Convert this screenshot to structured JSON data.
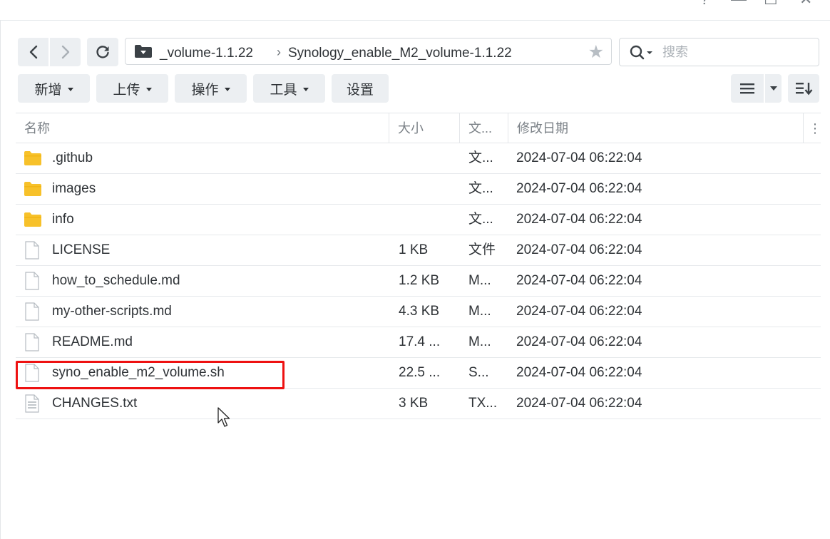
{
  "window": {
    "help_glyph": "?",
    "minimize_glyph": "—",
    "maximize_glyph": "☐",
    "close_glyph": "✕"
  },
  "nav": {
    "back_icon": "chevron-left-icon",
    "forward_icon": "chevron-right-icon",
    "refresh_icon": "refresh-icon"
  },
  "path": {
    "folder_icon": "folder-dropdown-icon",
    "crumbs": [
      "_volume-1.1.22",
      "Synology_enable_M2_volume-1.1.22"
    ],
    "separator": "›",
    "star_glyph": "★"
  },
  "search": {
    "icon": "search-icon",
    "placeholder": "搜索",
    "value": ""
  },
  "toolbar": {
    "buttons": [
      "新增",
      "上传",
      "操作",
      "工具",
      "设置"
    ]
  },
  "view": {
    "list_icon": "list-view-icon",
    "dropdown_icon": "caret-down-icon",
    "sort_icon": "sort-icon"
  },
  "table": {
    "columns": [
      "名称",
      "大小",
      "文...",
      "修改日期"
    ],
    "more_glyph": "⋮",
    "rows": [
      {
        "name": ".github",
        "size": "",
        "type": "文...",
        "modified": "2024-07-04 06:22:04",
        "icon": "folder-icon"
      },
      {
        "name": "images",
        "size": "",
        "type": "文...",
        "modified": "2024-07-04 06:22:04",
        "icon": "folder-icon"
      },
      {
        "name": "info",
        "size": "",
        "type": "文...",
        "modified": "2024-07-04 06:22:04",
        "icon": "folder-icon"
      },
      {
        "name": "LICENSE",
        "size": "1 KB",
        "type": "文件",
        "modified": "2024-07-04 06:22:04",
        "icon": "file-icon"
      },
      {
        "name": "how_to_schedule.md",
        "size": "1.2 KB",
        "type": "M...",
        "modified": "2024-07-04 06:22:04",
        "icon": "file-icon"
      },
      {
        "name": "my-other-scripts.md",
        "size": "4.3 KB",
        "type": "M...",
        "modified": "2024-07-04 06:22:04",
        "icon": "file-icon"
      },
      {
        "name": "README.md",
        "size": "17.4 ...",
        "type": "M...",
        "modified": "2024-07-04 06:22:04",
        "icon": "file-icon"
      },
      {
        "name": "syno_enable_m2_volume.sh",
        "size": "22.5 ...",
        "type": "S...",
        "modified": "2024-07-04 06:22:04",
        "icon": "file-icon",
        "highlighted": true
      },
      {
        "name": "CHANGES.txt",
        "size": "3 KB",
        "type": "TX...",
        "modified": "2024-07-04 06:22:04",
        "icon": "text-file-icon"
      }
    ]
  },
  "colors": {
    "accent_folder": "#f7c12a",
    "highlight": "#ee1111",
    "button_bg": "#eceff2"
  }
}
